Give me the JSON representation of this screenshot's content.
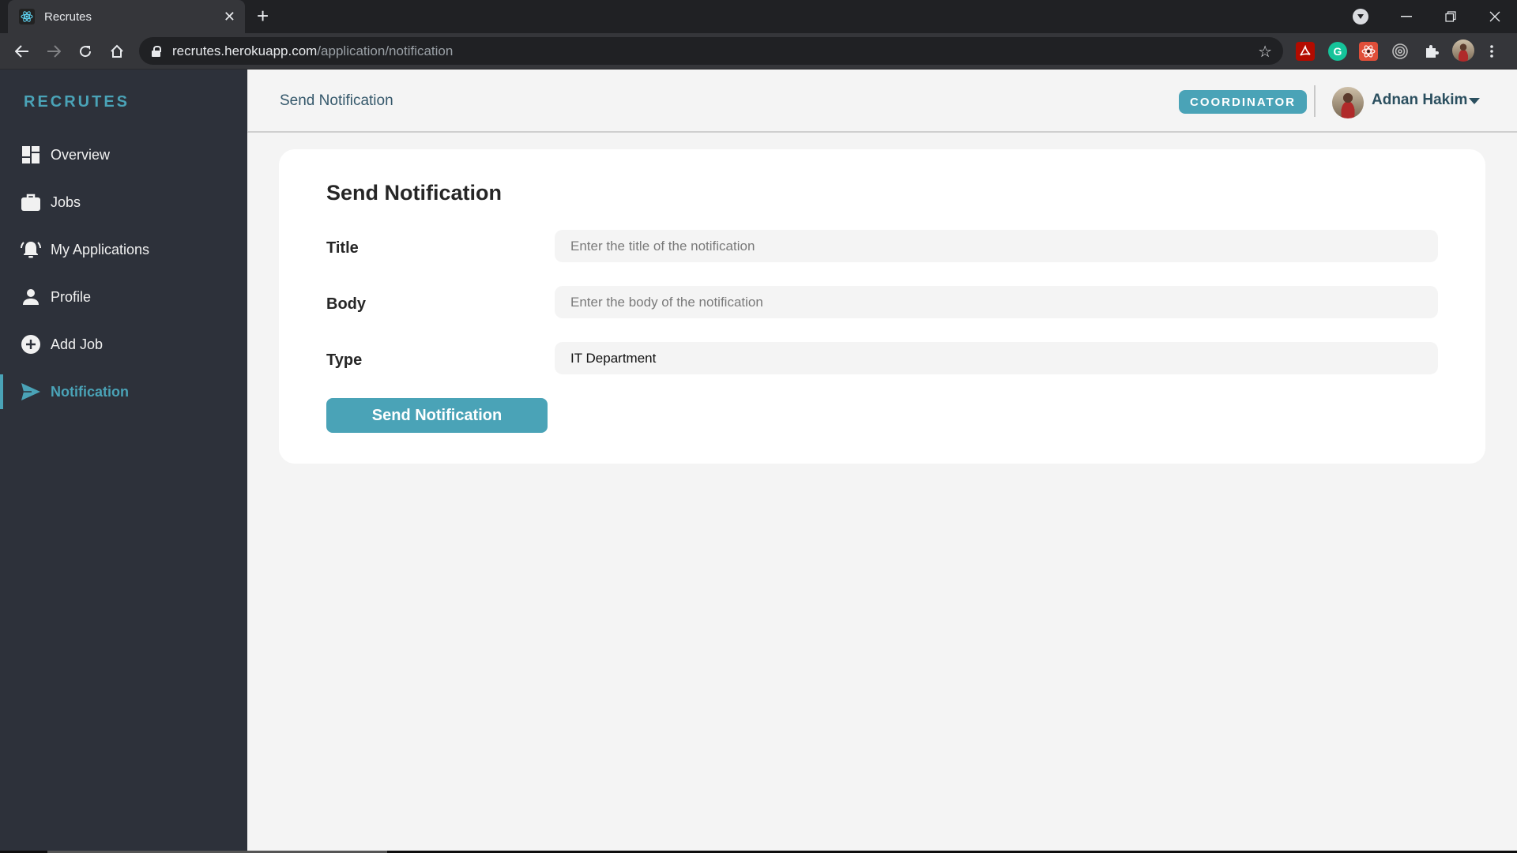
{
  "browser": {
    "tab_title": "Recrutes",
    "url_host": "recrutes.herokuapp.com",
    "url_path": "/application/notification",
    "extensions": [
      {
        "name": "adobe-acrobat-icon",
        "color": "#b30b00",
        "glyph": "A"
      },
      {
        "name": "grammarly-icon",
        "color": "#15c39a",
        "glyph": "G"
      },
      {
        "name": "react-devtools-icon",
        "color": "#e04e39",
        "glyph": "⚛"
      },
      {
        "name": "target-extension-icon",
        "color": "transparent",
        "glyph": "◎"
      },
      {
        "name": "extensions-puzzle-icon",
        "color": "transparent",
        "glyph": "✚"
      }
    ]
  },
  "sidebar": {
    "brand": "RECRUTES",
    "items": [
      {
        "label": "Overview",
        "icon": "dashboard-icon",
        "active": false
      },
      {
        "label": "Jobs",
        "icon": "briefcase-icon",
        "active": false
      },
      {
        "label": "My Applications",
        "icon": "bell-icon",
        "active": false
      },
      {
        "label": "Profile",
        "icon": "person-icon",
        "active": false
      },
      {
        "label": "Add Job",
        "icon": "plus-circle-icon",
        "active": false
      },
      {
        "label": "Notification",
        "icon": "send-icon",
        "active": true
      }
    ]
  },
  "header": {
    "title": "Send Notification",
    "role_badge": "COORDINATOR",
    "user_name": "Adnan Hakim"
  },
  "form": {
    "title": "Send Notification",
    "fields": [
      {
        "label": "Title",
        "value": "",
        "placeholder": "Enter the title of the notification"
      },
      {
        "label": "Body",
        "value": "",
        "placeholder": "Enter the body of the notification"
      },
      {
        "label": "Type",
        "value": "IT Department",
        "placeholder": ""
      }
    ],
    "submit_label": "Send Notification"
  },
  "colors": {
    "accent": "#4aa3b7",
    "sidebar_bg": "#2d313a",
    "page_bg": "#f4f4f4"
  }
}
